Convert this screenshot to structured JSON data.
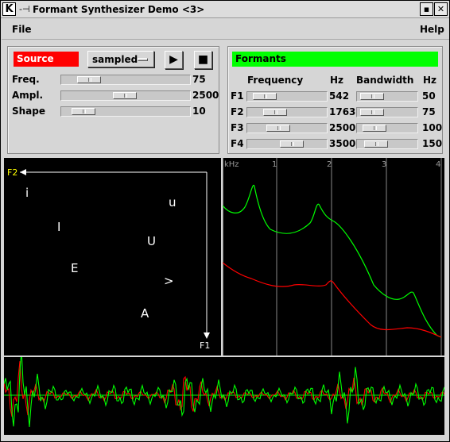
{
  "window": {
    "title": "Formant Synthesizer Demo <3>",
    "app_icon": "K",
    "grip": "-⊣",
    "minimize_glyph": "▪",
    "close_glyph": "✕"
  },
  "menu": {
    "file": "File",
    "help": "Help"
  },
  "source": {
    "header": "Source",
    "header_color": "#ff0000",
    "mode": "sampled",
    "play_glyph": "▶",
    "stop_glyph": "■",
    "params": [
      {
        "label": "Freq.",
        "value": "75",
        "level": 0.15
      },
      {
        "label": "Ampl.",
        "value": "2500",
        "level": 0.5
      },
      {
        "label": "Shape",
        "value": "10",
        "level": 0.1
      }
    ]
  },
  "formants": {
    "header": "Formants",
    "header_color": "#00ff00",
    "col_frequency": "Frequency",
    "col_hz1": "Hz",
    "col_bandwidth": "Bandwidth",
    "col_hz2": "Hz",
    "rows": [
      {
        "label": "F1",
        "freq": "542",
        "freq_level": 0.1,
        "bw": "50",
        "bw_level": 0.1
      },
      {
        "label": "F2",
        "freq": "1763",
        "freq_level": 0.3,
        "bw": "75",
        "bw_level": 0.1
      },
      {
        "label": "F3",
        "freq": "2500",
        "freq_level": 0.35,
        "bw": "100",
        "bw_level": 0.15
      },
      {
        "label": "F4",
        "freq": "3500",
        "freq_level": 0.6,
        "bw": "150",
        "bw_level": 0.2
      }
    ]
  },
  "vowel_chart": {
    "axis_y_label": "F2",
    "axis_x_label": "F1",
    "vowels": [
      {
        "symbol": "i"
      },
      {
        "symbol": "u"
      },
      {
        "symbol": "I"
      },
      {
        "symbol": "U"
      },
      {
        "symbol": "E"
      },
      {
        "symbol": ">"
      },
      {
        "symbol": "A"
      }
    ]
  },
  "spectrum": {
    "unit_label": "kHz",
    "ticks": [
      "1",
      "2",
      "3",
      "4"
    ],
    "green": "#00ff00",
    "red": "#ff0000"
  },
  "waveform": {
    "green": "#00ff00",
    "red": "#ff0000"
  }
}
